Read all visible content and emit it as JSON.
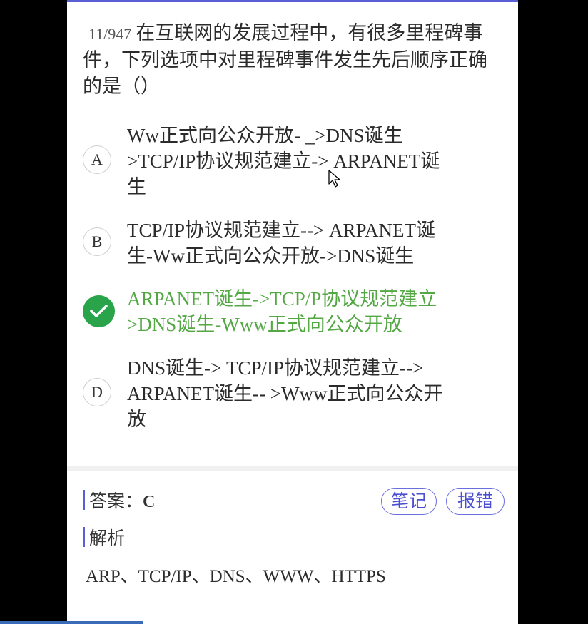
{
  "question": {
    "number": "11/947",
    "text": "在互联网的发展过程中，有很多里程碑事件，下列选项中对里程碑事件发生先后顺序正确的是（）"
  },
  "options": [
    {
      "letter": "A",
      "lines": [
        "Ww正式向公众开放- _>DNS诞生",
        ">TCP/IP协议规范建立-> ARPANET诞",
        "生"
      ],
      "state": "normal"
    },
    {
      "letter": "B",
      "lines": [
        "TCP/IP协议规范建立--> ARPANET诞",
        "生-Ww正式向公众开放->DNS诞生"
      ],
      "state": "normal"
    },
    {
      "letter": "C",
      "lines": [
        "ARPANET诞生->TCP/P协议规范建立",
        ">DNS诞生-Www正式向公众开放"
      ],
      "state": "correct"
    },
    {
      "letter": "D",
      "lines": [
        "DNS诞生-> TCP/IP协议规范建立-->",
        "ARPANET诞生-- >Www正式向公众开",
        "放"
      ],
      "state": "normal"
    }
  ],
  "answer": {
    "label": "答案：",
    "value": "C",
    "notes_button": "笔记",
    "report_button": "报错"
  },
  "analysis": {
    "label": "解析",
    "text": "ARP、TCP/IP、DNS、WWW、HTTPS"
  },
  "colors": {
    "accent": "#5b5fd6",
    "correct": "#53a844",
    "check_bg": "#2aa44a"
  }
}
